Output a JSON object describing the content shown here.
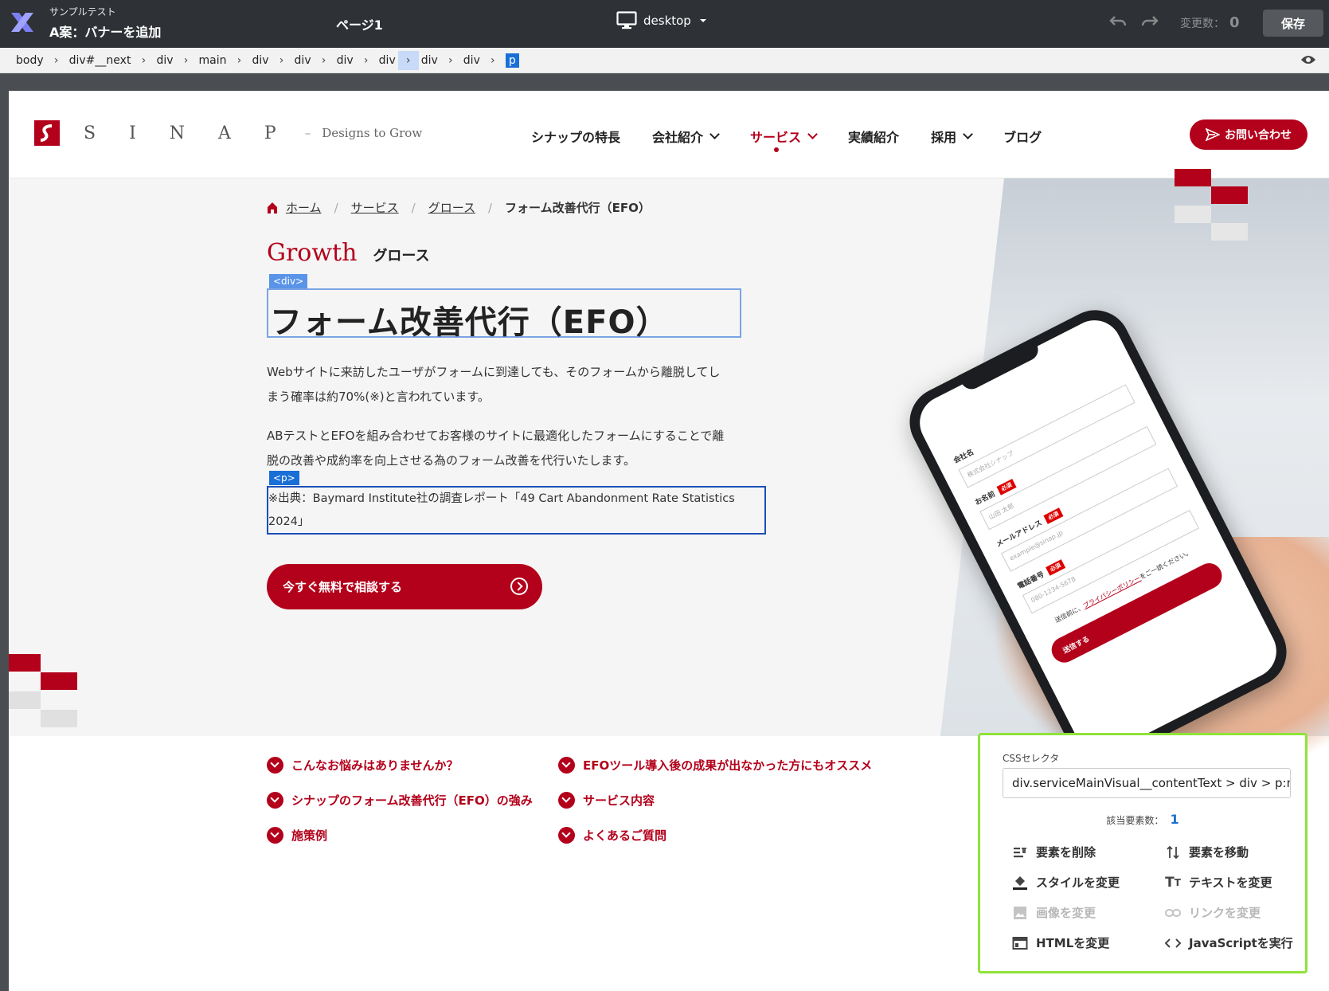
{
  "editor": {
    "project_sub": "サンプルテスト",
    "project_title": "A案：バナーを追加",
    "page_name": "ページ1",
    "device": "desktop",
    "changes_label": "変更数：",
    "changes_count": "0",
    "save_label": "保存"
  },
  "dom_path": [
    "body",
    "div#__next",
    "div",
    "main",
    "div",
    "div",
    "div",
    "div",
    "div",
    "div",
    "p"
  ],
  "site": {
    "brand_letters": "SINAP",
    "brand_dash": "–",
    "brand_tagline": "Designs to Grow",
    "nav": [
      {
        "label": "シナップの特長"
      },
      {
        "label": "会社紹介"
      },
      {
        "label": "サービス"
      },
      {
        "label": "実績紹介"
      },
      {
        "label": "採用"
      },
      {
        "label": "ブログ"
      }
    ],
    "contact_label": "お問い合わせ",
    "accent_color": "#b3001b"
  },
  "hero": {
    "breadcrumb": [
      "ホーム",
      "サービス",
      "グロース",
      "フォーム改善代行（EFO）"
    ],
    "eyebrow_en": "Growth",
    "eyebrow_jp": "グロース",
    "div_tag": "<div>",
    "p_tag": "<p>",
    "title": "フォーム改善代行（EFO）",
    "para1_line1": "Webサイトに来訪したユーザがフォームに到達しても、そのフォームから離脱してし",
    "para1_line2": "まう確率は約70%(※)と言われています。",
    "para2_line1": "ABテストとEFOを組み合わせてお客様のサイトに最適化したフォームにすることで離",
    "para2_line2": "脱の改善や成約率を向上させる為のフォーム改善を代行いたします。",
    "note_line1": "※出典：Baymard Institute社の調査レポート「49 Cart Abandonment Rate Statistics",
    "note_line2": "2024」",
    "cta_label": "今すぐ無料で相談する"
  },
  "phone_form": {
    "company_label": "会社名",
    "company_placeholder": "株式会社シナップ",
    "name_label": "お名前",
    "name_placeholder": "山田 太郎",
    "email_label": "メールアドレス",
    "email_placeholder": "example@sinap.jp",
    "phone_label": "電話番号",
    "phone_placeholder": "080-1234-5678",
    "required": "必須",
    "note_pre": "送信前に、",
    "note_link": "プライバシーポリシー",
    "note_post": "をご一読ください。",
    "submit": "送信する"
  },
  "toc": [
    "こんなお悩みはありませんか？",
    "EFOツール導入後の成果が出なかった方にもオススメ",
    "シナップのフォーム改善代行（EFO）の強み",
    "サービス内容",
    "施策例",
    "よくあるご質問"
  ],
  "panel": {
    "selector_label": "CSSセレクタ",
    "selector_value": "div.serviceMainVisual__contentText > div > p:nth-",
    "count_label": "該当要素数：",
    "count_value": "1",
    "actions": [
      {
        "label": "要素を削除",
        "icon": "delete-icon",
        "enabled": true
      },
      {
        "label": "要素を移動",
        "icon": "move-icon",
        "enabled": true
      },
      {
        "label": "スタイルを変更",
        "icon": "paint-bucket-icon",
        "enabled": true
      },
      {
        "label": "テキストを変更",
        "icon": "text-icon",
        "enabled": true
      },
      {
        "label": "画像を変更",
        "icon": "image-icon",
        "enabled": false
      },
      {
        "label": "リンクを変更",
        "icon": "link-icon",
        "enabled": false
      },
      {
        "label": "HTMLを変更",
        "icon": "html-window-icon",
        "enabled": true
      },
      {
        "label": "JavaScriptを実行",
        "icon": "code-icon",
        "enabled": true
      }
    ]
  }
}
